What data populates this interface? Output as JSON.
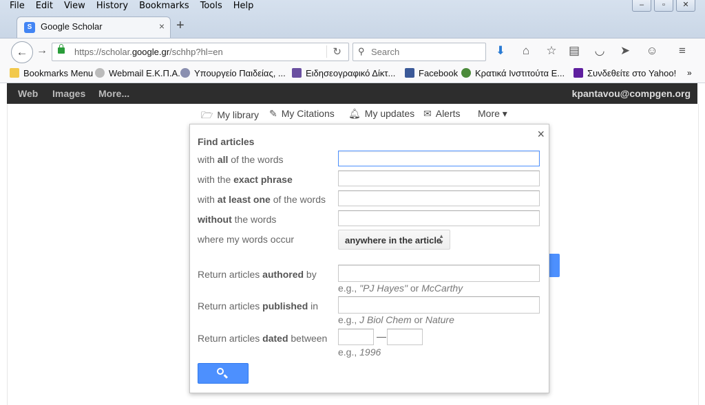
{
  "menubar": [
    "File",
    "Edit",
    "View",
    "History",
    "Bookmarks",
    "Tools",
    "Help"
  ],
  "tab": {
    "title": "Google Scholar",
    "close": "×",
    "new": "+"
  },
  "address": {
    "prefix": "https://scholar.",
    "host": "google.gr",
    "path": "/schhp?hl=en"
  },
  "search": {
    "placeholder": "Search"
  },
  "bookmarks": [
    {
      "label": "Bookmarks Menu"
    },
    {
      "label": "Webmail Ε.Κ.Π.Α."
    },
    {
      "label": "Υπουργείο Παιδείας, ..."
    },
    {
      "label": "Ειδησεογραφικό Δίκτ..."
    },
    {
      "label": "Facebook"
    },
    {
      "label": "Κρατικά Ινστιτούτα Ε..."
    },
    {
      "label": "Συνδεθείτε στο Yahoo!"
    }
  ],
  "gbar": {
    "web": "Web",
    "images": "Images",
    "more": "More...",
    "account": "kpantavou@compgen.org"
  },
  "scholar_nav": {
    "library": "My library",
    "citations": "My Citations",
    "updates": "My updates",
    "alerts": "Alerts",
    "more": "More ▾"
  },
  "advanced": {
    "close": "×",
    "title": "Find articles",
    "all_pre": "with ",
    "all_b": "all",
    "all_post": " of the words",
    "exact_pre": "with the ",
    "exact_b": "exact phrase",
    "least_pre": "with ",
    "least_b": "at least one",
    "least_post": " of the words",
    "without_b": "without",
    "without_post": " the words",
    "where": "where my words occur",
    "where_value": "anywhere in the article",
    "author_pre": "Return articles ",
    "author_b": "authored",
    "author_post": " by",
    "author_hint_pre": "e.g., ",
    "author_hint_1": "\"PJ Hayes\"",
    "author_hint_mid": " or ",
    "author_hint_2": "McCarthy",
    "pub_pre": "Return articles ",
    "pub_b": "published",
    "pub_post": " in",
    "pub_hint_pre": "e.g., ",
    "pub_hint_1": "J Biol Chem",
    "pub_hint_mid": " or ",
    "pub_hint_2": "Nature",
    "date_pre": "Return articles ",
    "date_b": "dated",
    "date_post": " between",
    "date_sep": "—",
    "date_hint_pre": "e.g., ",
    "date_hint_1": "1996"
  }
}
